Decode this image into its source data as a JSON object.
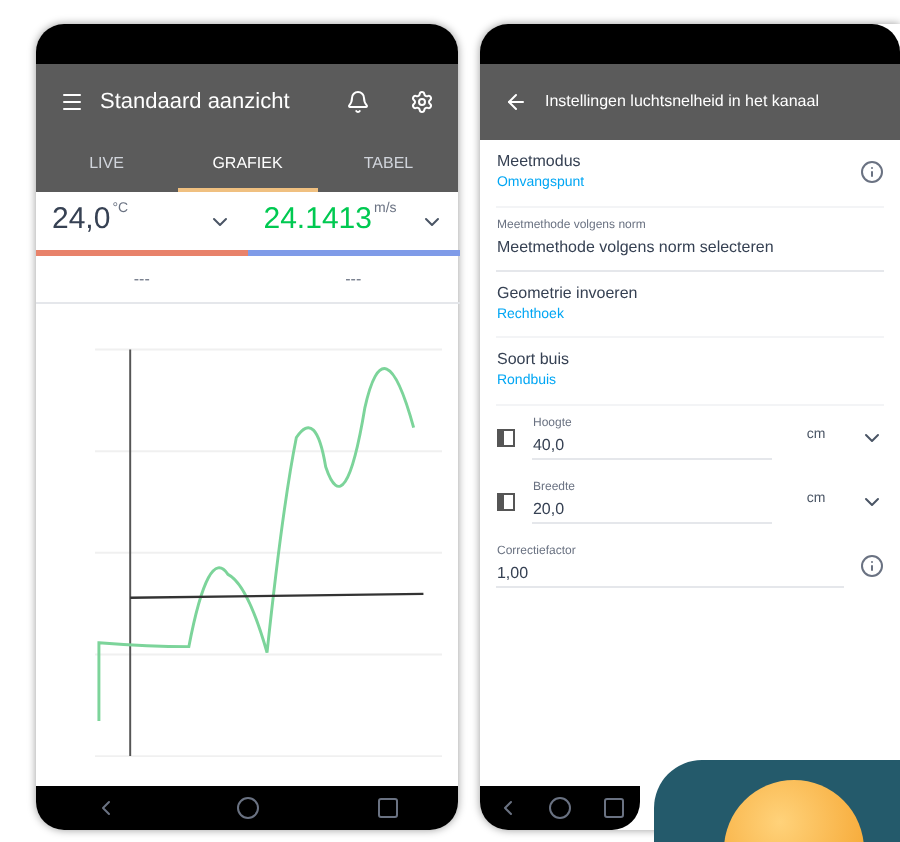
{
  "left_screen": {
    "app_bar": {
      "title": "Standaard aanzicht"
    },
    "tabs": [
      {
        "label": "LIVE",
        "selected": false
      },
      {
        "label": "GRAFIEK",
        "selected": true
      },
      {
        "label": "TABEL",
        "selected": false
      }
    ],
    "readings": [
      {
        "value": "24,0",
        "unit": "°C",
        "color": "#e8826a",
        "select": "---"
      },
      {
        "value": "24.1413",
        "unit": "m/s",
        "color": "#7f9be8",
        "select": "---"
      }
    ]
  },
  "right_screen": {
    "app_bar": {
      "title": "Instellingen luchtsnelheid in het kanaal"
    },
    "settings": [
      {
        "kind": "option",
        "label": "Meetmodus",
        "value": "Omvangspunt",
        "info": true
      },
      {
        "kind": "field",
        "label": "Meetmethode volgens norm",
        "value": "Meetmethode volgens norm selecteren"
      },
      {
        "kind": "option",
        "label": "Geometrie invoeren",
        "value": "Rechthoek",
        "info": false
      },
      {
        "kind": "option",
        "label": "Soort buis",
        "value": "Rondbuis",
        "info": false
      },
      {
        "kind": "dimension",
        "label": "Hoogte",
        "value": "40,0",
        "unit": "cm"
      },
      {
        "kind": "dimension",
        "label": "Breedte",
        "value": "20,0",
        "unit": "cm"
      },
      {
        "kind": "factor",
        "label": "Correctiefactor",
        "value": "1,00"
      }
    ]
  }
}
